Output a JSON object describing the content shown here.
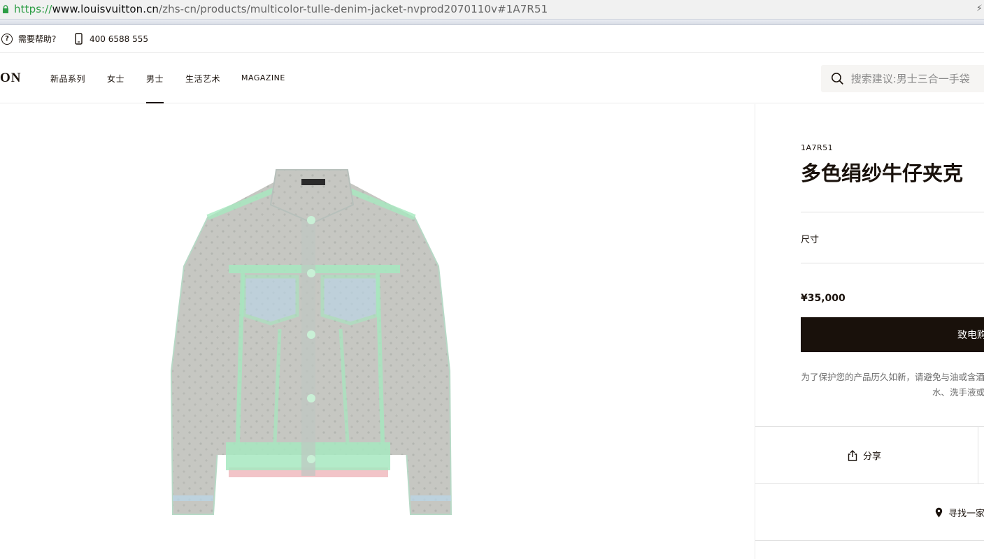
{
  "browser": {
    "url_scheme": "https://",
    "url_host": "www.louisvuitton.cn",
    "url_path": "/zhs-cn/products/multicolor-tulle-denim-jacket-nvprod2070110v#1A7R51"
  },
  "helpbar": {
    "help_label": "需要帮助?",
    "phone_number": "400 6588 555"
  },
  "nav": {
    "logo_text": "ON",
    "items": [
      "新品系列",
      "女士",
      "男士",
      "生活艺术",
      "MAGAZINE"
    ],
    "active_item": "男士",
    "search_placeholder": "搜索建议:男士三合一手袋"
  },
  "product": {
    "sku": "1A7R51",
    "name": "多色绢纱牛仔夹克",
    "size_label": "尺寸",
    "price": "¥35,000",
    "buy_button_label": "致电购",
    "care_line1": "为了保护您的产品历久如新，请避免与油或含酒",
    "care_line2": "水、洗手液或",
    "share_label": "分享",
    "store_label": "寻找一家"
  },
  "colors": {
    "brand_dark": "#19110b",
    "jacket_tulle": "#c5c6c1",
    "jacket_trim_green": "#a6e8bf",
    "jacket_trim_pink": "#f2c4c8",
    "jacket_trim_blue": "#b9d7ea"
  },
  "icons": [
    "lock-icon",
    "help-circle-icon",
    "phone-icon",
    "search-icon",
    "share-icon",
    "location-pin-icon"
  ]
}
